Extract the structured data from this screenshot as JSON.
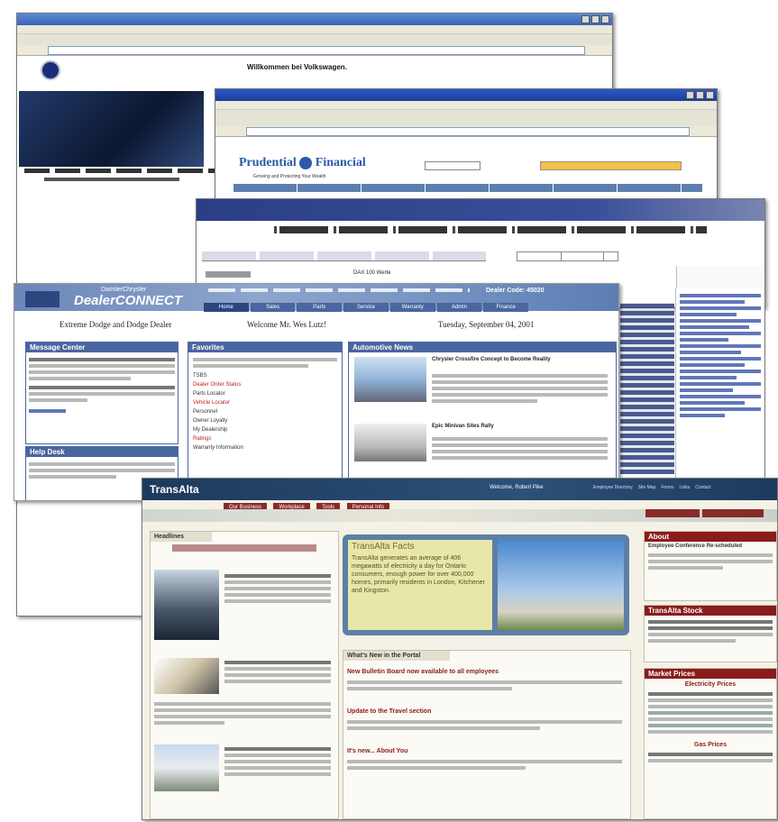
{
  "vw": {
    "welcome": "Willkommen bei Volkswagen."
  },
  "prudential": {
    "logo": "Prudential",
    "logo2": "Financial",
    "tagline": "Growing and Protecting Your Wealth"
  },
  "dax": {
    "tab_label": "DAX 100 Werte"
  },
  "chrysler": {
    "logo_top": "DaimlerChrysler",
    "logo_main": "DealerCONNECT",
    "dealer_code": "Dealer Code: 45020",
    "dealer_name": "Extreme Dodge and Dodge Dealer",
    "welcome": "Welcome Mr. Wes Lutz!",
    "date": "Tuesday, September 04, 2001",
    "tabs": [
      "Home",
      "Sales",
      "Parts",
      "Service",
      "Warranty",
      "Admin",
      "Finance"
    ],
    "message_center": "Message Center",
    "help_desk": "Help Desk",
    "favorites": "Favorites",
    "automotive_news": "Automotive News",
    "fav_items": [
      "TSBS",
      "Dealer Order Status",
      "Parts Locator",
      "Vehicle Locator",
      "Personnel",
      "Owner Loyalty",
      "My Dealership",
      "Ratings",
      "Warranty Information"
    ],
    "news1_title": "Chrysler Crossfire Concept to Become Reality",
    "news2_title": "Epic Minivan Sites Rally"
  },
  "transalta": {
    "logo": "TransAlta",
    "greeting": "Welcome, Robert Pike",
    "top_links": [
      "Employee Directory",
      "Site Map",
      "Forms",
      "Links",
      "Contact"
    ],
    "nav_tabs": [
      "Our Business",
      "Workplace",
      "Tools",
      "Personal Info"
    ],
    "headlines": "Headlines",
    "facts_title": "TransAlta Facts",
    "facts_text": "TransAlta generates an average of 406 megawatts of electricity a day for Ontario consumers, enough power for over 400,000 homes, primarily residents in London, Kitchener and Kingston.",
    "whats_new": "What's New in the Portal",
    "news_items": [
      "New Bulletin Board now available to all employees",
      "Update to the Travel section",
      "It's new... About You"
    ],
    "stock": "TransAlta Stock",
    "market_prices": "Market Prices",
    "electricity_prices": "Electricity Prices",
    "gas_prices": "Gas Prices",
    "about": "About",
    "about_title": "Employee Conference Re-scheduled"
  }
}
